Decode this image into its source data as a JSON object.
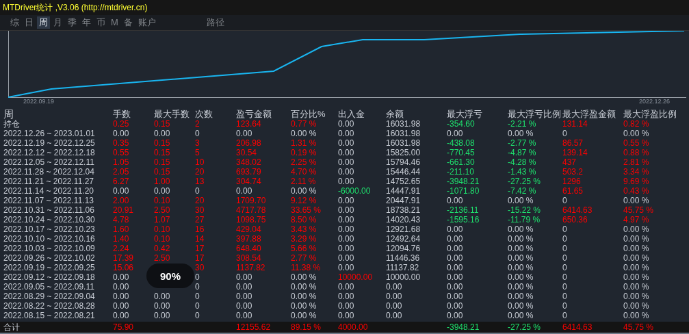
{
  "window": {
    "title": "MTDriver统计 ,V3.06 (http://mtdriver.cn)"
  },
  "tabs": [
    {
      "label": "综",
      "selected": false
    },
    {
      "label": "日",
      "selected": false
    },
    {
      "label": "周",
      "selected": true
    },
    {
      "label": "月",
      "selected": false
    },
    {
      "label": "季",
      "selected": false
    },
    {
      "label": "年",
      "selected": false
    },
    {
      "label": "币",
      "selected": false
    },
    {
      "label": "M",
      "selected": false
    },
    {
      "label": "备",
      "selected": false
    },
    {
      "label": "账户",
      "selected": false
    }
  ],
  "path_button": {
    "label": "路径"
  },
  "chart": {
    "start_label": "2022.09.19",
    "end_label": "2022.12.26"
  },
  "table": {
    "columns": [
      "周",
      "手数",
      "最大手数",
      "次数",
      "盈亏金额",
      "百分比%",
      "出入金",
      "余额",
      "最大浮亏",
      "最大浮亏比例",
      "最大浮盈金额",
      "最大浮盈比例"
    ],
    "rows": [
      {
        "period": "持仓",
        "lots": {
          "text": "0.25",
          "color": "#ff0000"
        },
        "max_lots": {
          "text": "0.15",
          "color": "#ff0000"
        },
        "trades": {
          "text": "2",
          "color": "#ff0000"
        },
        "profit": {
          "text": "123.64",
          "color": "#ff0000"
        },
        "percent": {
          "text": "0.77 %",
          "color": "#ff0000"
        },
        "deposit": "0.00",
        "balance": "16031.98",
        "max_float_loss": {
          "text": "-354.60",
          "color": "#1ee36e"
        },
        "max_float_loss_pct": {
          "text": "-2.21 %",
          "color": "#1ee36e"
        },
        "max_float_profit": {
          "text": "131.14",
          "color": "#ff0000"
        },
        "max_float_profit_pct": {
          "text": "0.82 %",
          "color": "#ff0000"
        }
      },
      {
        "period": "2022.12.26 ~ 2023.01.01",
        "lots": "0.00",
        "max_lots": "0.00",
        "trades": "0",
        "profit": "0.00",
        "percent": "0.00 %",
        "deposit": "0.00",
        "balance": "16031.98",
        "max_float_loss": "0.00",
        "max_float_loss_pct": "0.00 %",
        "max_float_profit": "0",
        "max_float_profit_pct": "0.00 %"
      },
      {
        "period": "2022.12.19 ~ 2022.12.25",
        "lots": {
          "text": "0.35",
          "color": "#ff0000"
        },
        "max_lots": {
          "text": "0.15",
          "color": "#ff0000"
        },
        "trades": {
          "text": "3",
          "color": "#ff0000"
        },
        "profit": {
          "text": "206.98",
          "color": "#ff0000"
        },
        "percent": {
          "text": "1.31 %",
          "color": "#ff0000"
        },
        "deposit": "0.00",
        "balance": "16031.98",
        "max_float_loss": {
          "text": "-438.08",
          "color": "#1ee36e"
        },
        "max_float_loss_pct": {
          "text": "-2.77 %",
          "color": "#1ee36e"
        },
        "max_float_profit": {
          "text": "86.57",
          "color": "#ff0000"
        },
        "max_float_profit_pct": {
          "text": "0.55 %",
          "color": "#ff0000"
        }
      },
      {
        "period": "2022.12.12 ~ 2022.12.18",
        "lots": {
          "text": "0.55",
          "color": "#ff0000"
        },
        "max_lots": {
          "text": "0.15",
          "color": "#ff0000"
        },
        "trades": {
          "text": "5",
          "color": "#ff0000"
        },
        "profit": {
          "text": "30.54",
          "color": "#ff0000"
        },
        "percent": {
          "text": "0.19 %",
          "color": "#ff0000"
        },
        "deposit": "0.00",
        "balance": "15825.00",
        "max_float_loss": {
          "text": "-770.45",
          "color": "#1ee36e"
        },
        "max_float_loss_pct": {
          "text": "-4.87 %",
          "color": "#1ee36e"
        },
        "max_float_profit": {
          "text": "139.14",
          "color": "#ff0000"
        },
        "max_float_profit_pct": {
          "text": "0.88 %",
          "color": "#ff0000"
        }
      },
      {
        "period": "2022.12.05 ~ 2022.12.11",
        "lots": {
          "text": "1.05",
          "color": "#ff0000"
        },
        "max_lots": {
          "text": "0.15",
          "color": "#ff0000"
        },
        "trades": {
          "text": "10",
          "color": "#ff0000"
        },
        "profit": {
          "text": "348.02",
          "color": "#ff0000"
        },
        "percent": {
          "text": "2.25 %",
          "color": "#ff0000"
        },
        "deposit": "0.00",
        "balance": "15794.46",
        "max_float_loss": {
          "text": "-661.30",
          "color": "#1ee36e"
        },
        "max_float_loss_pct": {
          "text": "-4.28 %",
          "color": "#1ee36e"
        },
        "max_float_profit": {
          "text": "437",
          "color": "#ff0000"
        },
        "max_float_profit_pct": {
          "text": "2.81 %",
          "color": "#ff0000"
        }
      },
      {
        "period": "2022.11.28 ~ 2022.12.04",
        "lots": {
          "text": "2.05",
          "color": "#ff0000"
        },
        "max_lots": {
          "text": "0.15",
          "color": "#ff0000"
        },
        "trades": {
          "text": "20",
          "color": "#ff0000"
        },
        "profit": {
          "text": "693.79",
          "color": "#ff0000"
        },
        "percent": {
          "text": "4.70 %",
          "color": "#ff0000"
        },
        "deposit": "0.00",
        "balance": "15446.44",
        "max_float_loss": {
          "text": "-211.10",
          "color": "#1ee36e"
        },
        "max_float_loss_pct": {
          "text": "-1.43 %",
          "color": "#1ee36e"
        },
        "max_float_profit": {
          "text": "503.2",
          "color": "#ff0000"
        },
        "max_float_profit_pct": {
          "text": "3.34 %",
          "color": "#ff0000"
        }
      },
      {
        "period": "2022.11.21 ~ 2022.11.27",
        "lots": {
          "text": "6.27",
          "color": "#ff0000"
        },
        "max_lots": {
          "text": "1.00",
          "color": "#ff0000"
        },
        "trades": {
          "text": "13",
          "color": "#ff0000"
        },
        "profit": {
          "text": "304.74",
          "color": "#ff0000"
        },
        "percent": {
          "text": "2.11 %",
          "color": "#ff0000"
        },
        "deposit": "0.00",
        "balance": "14752.65",
        "max_float_loss": {
          "text": "-3948.21",
          "color": "#1ee36e"
        },
        "max_float_loss_pct": {
          "text": "-27.25 %",
          "color": "#1ee36e"
        },
        "max_float_profit": {
          "text": "1296",
          "color": "#ff0000"
        },
        "max_float_profit_pct": {
          "text": "9.69 %",
          "color": "#ff0000"
        }
      },
      {
        "period": "2022.11.14 ~ 2022.11.20",
        "lots": "0.00",
        "max_lots": "0.00",
        "trades": "0",
        "profit": "0.00",
        "percent": "0.00 %",
        "deposit": {
          "text": "-6000.00",
          "color": "#1ee36e"
        },
        "balance": "14447.91",
        "max_float_loss": {
          "text": "-1071.80",
          "color": "#1ee36e"
        },
        "max_float_loss_pct": {
          "text": "-7.42 %",
          "color": "#1ee36e"
        },
        "max_float_profit": {
          "text": "61.65",
          "color": "#ff0000"
        },
        "max_float_profit_pct": {
          "text": "0.43 %",
          "color": "#ff0000"
        }
      },
      {
        "period": "2022.11.07 ~ 2022.11.13",
        "lots": {
          "text": "2.00",
          "color": "#ff0000"
        },
        "max_lots": {
          "text": "0.10",
          "color": "#ff0000"
        },
        "trades": {
          "text": "20",
          "color": "#ff0000"
        },
        "profit": {
          "text": "1709.70",
          "color": "#ff0000"
        },
        "percent": {
          "text": "9.12 %",
          "color": "#ff0000"
        },
        "deposit": "0.00",
        "balance": "20447.91",
        "max_float_loss": "0.00",
        "max_float_loss_pct": "0.00 %",
        "max_float_profit": "0",
        "max_float_profit_pct": "0.00 %"
      },
      {
        "period": "2022.10.31 ~ 2022.11.06",
        "lots": {
          "text": "20.91",
          "color": "#ff0000"
        },
        "max_lots": {
          "text": "2.50",
          "color": "#ff0000"
        },
        "trades": {
          "text": "30",
          "color": "#ff0000"
        },
        "profit": {
          "text": "4717.78",
          "color": "#ff0000"
        },
        "percent": {
          "text": "33.65 %",
          "color": "#ff0000"
        },
        "deposit": "0.00",
        "balance": "18738.21",
        "max_float_loss": {
          "text": "-2136.11",
          "color": "#1ee36e"
        },
        "max_float_loss_pct": {
          "text": "-15.22 %",
          "color": "#1ee36e"
        },
        "max_float_profit": {
          "text": "6414.63",
          "color": "#ff0000"
        },
        "max_float_profit_pct": {
          "text": "45.75 %",
          "color": "#ff0000"
        }
      },
      {
        "period": "2022.10.24 ~ 2022.10.30",
        "lots": {
          "text": "4.78",
          "color": "#ff0000"
        },
        "max_lots": {
          "text": "1.07",
          "color": "#ff0000"
        },
        "trades": {
          "text": "27",
          "color": "#ff0000"
        },
        "profit": {
          "text": "1098.75",
          "color": "#ff0000"
        },
        "percent": {
          "text": "8.50 %",
          "color": "#ff0000"
        },
        "deposit": "0.00",
        "balance": "14020.43",
        "max_float_loss": {
          "text": "-1595.16",
          "color": "#1ee36e"
        },
        "max_float_loss_pct": {
          "text": "-11.79 %",
          "color": "#1ee36e"
        },
        "max_float_profit": {
          "text": "650.36",
          "color": "#ff0000"
        },
        "max_float_profit_pct": {
          "text": "4.97 %",
          "color": "#ff0000"
        }
      },
      {
        "period": "2022.10.17 ~ 2022.10.23",
        "lots": {
          "text": "1.60",
          "color": "#ff0000"
        },
        "max_lots": {
          "text": "0.10",
          "color": "#ff0000"
        },
        "trades": {
          "text": "16",
          "color": "#ff0000"
        },
        "profit": {
          "text": "429.04",
          "color": "#ff0000"
        },
        "percent": {
          "text": "3.43 %",
          "color": "#ff0000"
        },
        "deposit": "0.00",
        "balance": "12921.68",
        "max_float_loss": "0.00",
        "max_float_loss_pct": "0.00 %",
        "max_float_profit": "0",
        "max_float_profit_pct": "0.00 %"
      },
      {
        "period": "2022.10.10 ~ 2022.10.16",
        "lots": {
          "text": "1.40",
          "color": "#ff0000"
        },
        "max_lots": {
          "text": "0.10",
          "color": "#ff0000"
        },
        "trades": {
          "text": "14",
          "color": "#ff0000"
        },
        "profit": {
          "text": "397.88",
          "color": "#ff0000"
        },
        "percent": {
          "text": "3.29 %",
          "color": "#ff0000"
        },
        "deposit": "0.00",
        "balance": "12492.64",
        "max_float_loss": "0.00",
        "max_float_loss_pct": "0.00 %",
        "max_float_profit": "0",
        "max_float_profit_pct": "0.00 %"
      },
      {
        "period": "2022.10.03 ~ 2022.10.09",
        "lots": {
          "text": "2.24",
          "color": "#ff0000"
        },
        "max_lots": {
          "text": "0.42",
          "color": "#ff0000"
        },
        "trades": {
          "text": "17",
          "color": "#ff0000"
        },
        "profit": {
          "text": "648.40",
          "color": "#ff0000"
        },
        "percent": {
          "text": "5.66 %",
          "color": "#ff0000"
        },
        "deposit": "0.00",
        "balance": "12094.76",
        "max_float_loss": "0.00",
        "max_float_loss_pct": "0.00 %",
        "max_float_profit": "0",
        "max_float_profit_pct": "0.00 %"
      },
      {
        "period": "2022.09.26 ~ 2022.10.02",
        "lots": {
          "text": "17.39",
          "color": "#ff0000"
        },
        "max_lots": {
          "text": "2.50",
          "color": "#ff0000"
        },
        "trades": {
          "text": "17",
          "color": "#ff0000"
        },
        "profit": {
          "text": "308.54",
          "color": "#ff0000"
        },
        "percent": {
          "text": "2.77 %",
          "color": "#ff0000"
        },
        "deposit": "0.00",
        "balance": "11446.36",
        "max_float_loss": "0.00",
        "max_float_loss_pct": "0.00 %",
        "max_float_profit": "0",
        "max_float_profit_pct": "0.00 %"
      },
      {
        "period": "2022.09.19 ~ 2022.09.25",
        "lots": {
          "text": "15.06",
          "color": "#ff0000"
        },
        "trades": {
          "text": "30",
          "color": "#ff0000"
        },
        "profit": {
          "text": "1137.82",
          "color": "#ff0000"
        },
        "percent": {
          "text": "11.38 %",
          "color": "#ff0000"
        },
        "deposit": "0.00",
        "balance": "11137.82",
        "max_float_loss": "0.00",
        "max_float_loss_pct": "0.00 %",
        "max_float_profit": "0",
        "max_float_profit_pct": "0.00 %"
      },
      {
        "period": "2022.09.12 ~ 2022.09.18",
        "lots": "0.00",
        "trades": "0",
        "profit": "0.00",
        "percent": "0.00 %",
        "deposit": {
          "text": "10000.00",
          "color": "#ff0000"
        },
        "balance": "10000.00",
        "max_float_loss": "0.00",
        "max_float_loss_pct": "0.00 %",
        "max_float_profit": "0",
        "max_float_profit_pct": "0.00 %"
      },
      {
        "period": "2022.09.05 ~ 2022.09.11",
        "lots": "0.00",
        "trades": "0",
        "profit": "0.00",
        "percent": "0.00 %",
        "deposit": "0.00",
        "balance": "0.00",
        "max_float_loss": "0.00",
        "max_float_loss_pct": "0.00 %",
        "max_float_profit": "0",
        "max_float_profit_pct": "0.00 %"
      },
      {
        "period": "2022.08.29 ~ 2022.09.04",
        "lots": "0.00",
        "max_lots": "0.00",
        "trades": "0",
        "profit": "0.00",
        "percent": "0.00 %",
        "deposit": "0.00",
        "balance": "0.00",
        "max_float_loss": "0.00",
        "max_float_loss_pct": "0.00 %",
        "max_float_profit": "0",
        "max_float_profit_pct": "0.00 %"
      },
      {
        "period": "2022.08.22 ~ 2022.08.28",
        "lots": "0.00",
        "max_lots": "0.00",
        "trades": "0",
        "profit": "0.00",
        "percent": "0.00 %",
        "deposit": "0.00",
        "balance": "0.00",
        "max_float_loss": "0.00",
        "max_float_loss_pct": "0.00 %",
        "max_float_profit": "0",
        "max_float_profit_pct": "0.00 %"
      },
      {
        "period": "2022.08.15 ~ 2022.08.21",
        "lots": "0.00",
        "max_lots": "0.00",
        "trades": "0",
        "profit": "0.00",
        "percent": "0.00 %",
        "deposit": "0.00",
        "balance": "0.00",
        "max_float_loss": "0.00",
        "max_float_loss_pct": "0.00 %",
        "max_float_profit": "0",
        "max_float_profit_pct": "0.00 %"
      }
    ],
    "total": {
      "period": "合计",
      "lots": {
        "text": "75.90",
        "color": "#ff0000"
      },
      "profit": {
        "text": "12155.62",
        "color": "#ff0000"
      },
      "percent": {
        "text": "89.15 %",
        "color": "#ff0000"
      },
      "deposit": {
        "text": "4000.00",
        "color": "#ff0000"
      },
      "max_float_loss": {
        "text": "-3948.21",
        "color": "#1ee36e"
      },
      "max_float_loss_pct": {
        "text": "-27.25 %",
        "color": "#1ee36e"
      },
      "max_float_profit": {
        "text": "6414.63",
        "color": "#ff0000"
      },
      "max_float_profit_pct": {
        "text": "45.75 %",
        "color": "#ff0000"
      }
    }
  },
  "zoom_indicator": "90%"
}
